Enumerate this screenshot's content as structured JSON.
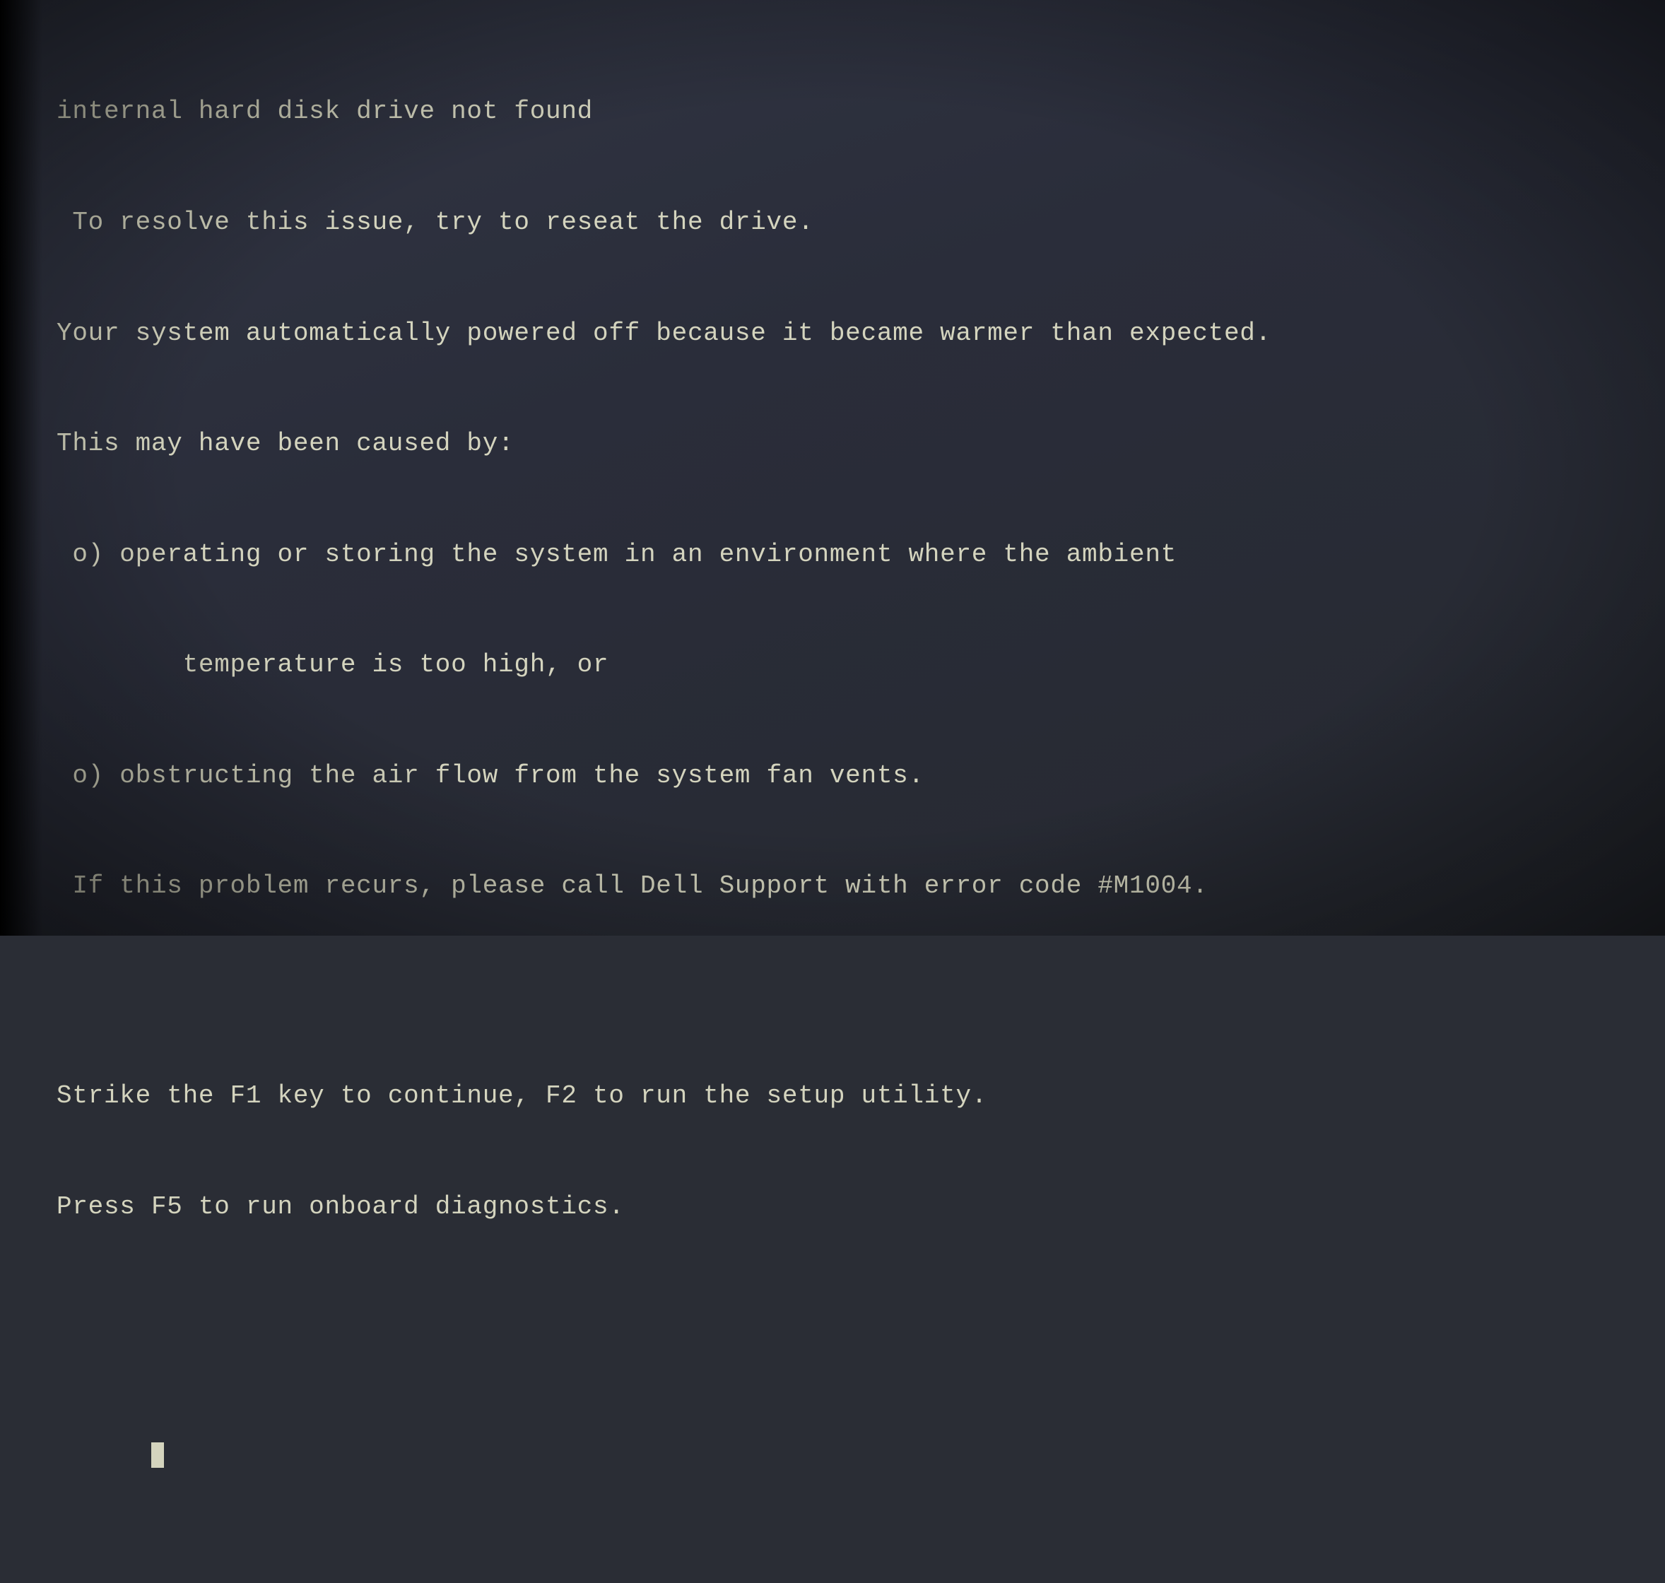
{
  "screen": {
    "background_color": "#2e3240",
    "text_color": "#d4d4be"
  },
  "lines": [
    {
      "id": "line1",
      "text": "internal hard disk drive not found"
    },
    {
      "id": "line2",
      "text": " To resolve this issue, try to reseat the drive."
    },
    {
      "id": "line3",
      "text": "Your system automatically powered off because it became warmer than expected."
    },
    {
      "id": "line4",
      "text": "This may have been caused by:"
    },
    {
      "id": "line5",
      "text": " o) operating or storing the system in an environment where the ambient"
    },
    {
      "id": "line6",
      "text": "        temperature is too high, or"
    },
    {
      "id": "line7",
      "text": " o) obstructing the air flow from the system fan vents."
    },
    {
      "id": "line8",
      "text": " If this problem recurs, please call Dell Support with error code #M1004."
    },
    {
      "id": "spacer",
      "text": ""
    },
    {
      "id": "line9",
      "text": "Strike the F1 key to continue, F2 to run the setup utility."
    },
    {
      "id": "line10",
      "text": "Press F5 to run onboard diagnostics."
    }
  ],
  "cursor": {
    "visible": true,
    "label": "_"
  }
}
